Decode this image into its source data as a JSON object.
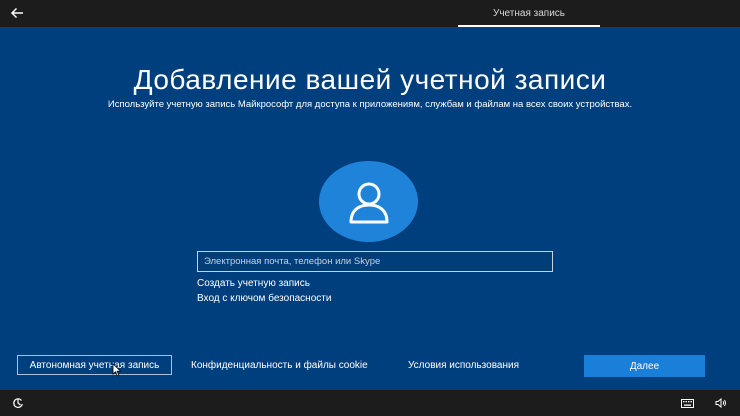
{
  "header": {
    "tab_label": "Учетная запись"
  },
  "main": {
    "title": "Добавление вашей учетной записи",
    "subtitle": "Используйте учетную запись Майкрософт для доступа к приложениям, службам и файлам на всех своих устройствах.",
    "email_placeholder": "Электронная почта, телефон или Skype",
    "email_value": "",
    "create_account_link": "Создать учетную запись",
    "security_key_link": "Вход с ключом безопасности"
  },
  "footer": {
    "offline_account_button": "Автономная учетная запись",
    "privacy_link": "Конфиденциальность и файлы cookie",
    "terms_link": "Условия использования",
    "next_button": "Далее"
  },
  "icons": {
    "back": "back-arrow-icon",
    "avatar": "user-icon",
    "ease_of_access": "ease-of-access-icon",
    "keyboard": "keyboard-icon",
    "volume": "volume-icon"
  },
  "colors": {
    "background": "#003f7e",
    "bar": "#1c1c1c",
    "accent": "#1a7fd8",
    "avatar_circle": "#1f84d9"
  }
}
